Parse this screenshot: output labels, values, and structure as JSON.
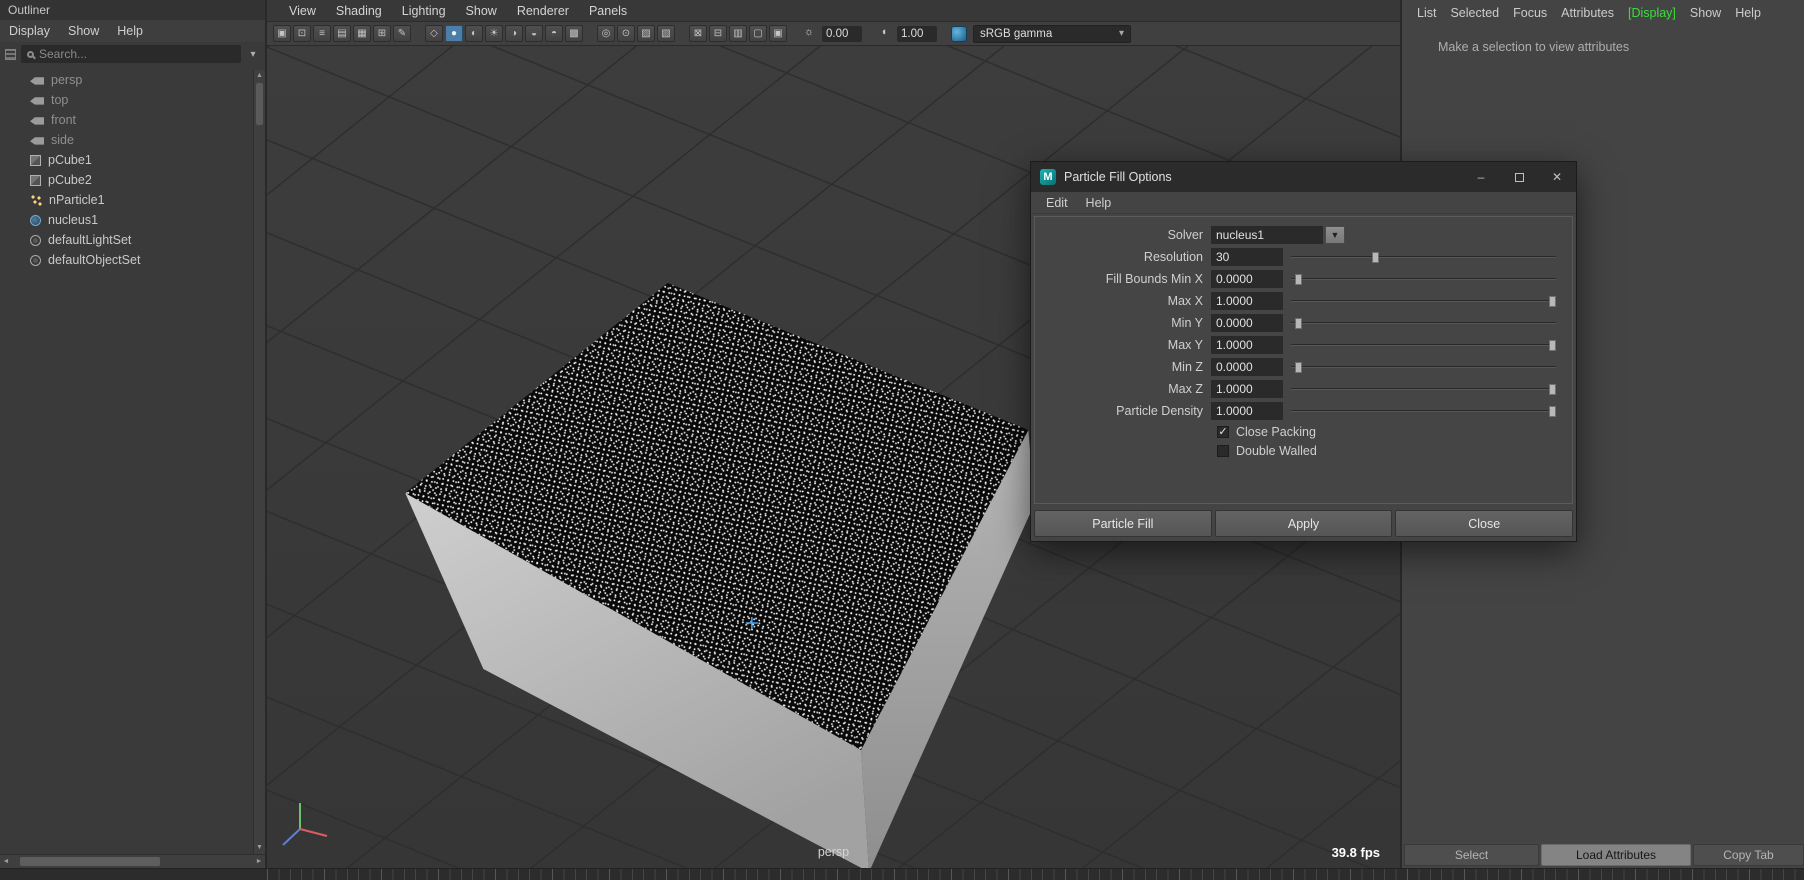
{
  "glyphs": {
    "dropdown_caret": "▾",
    "dropdown_arrow": "▼",
    "checkmark": "✓",
    "scroll_up": "▲",
    "scroll_down": "▼",
    "scroll_left": "◄",
    "scroll_right": "►",
    "minimize": "–",
    "close": "✕"
  },
  "outliner": {
    "title": "Outliner",
    "menus": [
      "Display",
      "Show",
      "Help"
    ],
    "search_placeholder": "Search...",
    "items": [
      {
        "label": "persp",
        "icon": "camera",
        "icon_name": "camera-icon",
        "dim": true
      },
      {
        "label": "top",
        "icon": "camera",
        "icon_name": "camera-icon",
        "dim": true
      },
      {
        "label": "front",
        "icon": "camera",
        "icon_name": "camera-icon",
        "dim": true
      },
      {
        "label": "side",
        "icon": "camera",
        "icon_name": "camera-icon",
        "dim": true
      },
      {
        "label": "pCube1",
        "icon": "cube",
        "icon_name": "poly-cube-icon"
      },
      {
        "label": "pCube2",
        "icon": "cube",
        "icon_name": "poly-cube-icon"
      },
      {
        "label": "nParticle1",
        "icon": "particle",
        "icon_name": "nparticle-icon"
      },
      {
        "label": "nucleus1",
        "icon": "nucleus",
        "icon_name": "nucleus-icon"
      },
      {
        "label": "defaultLightSet",
        "icon": "set",
        "icon_name": "light-set-icon"
      },
      {
        "label": "defaultObjectSet",
        "icon": "set",
        "icon_name": "object-set-icon"
      }
    ]
  },
  "viewport": {
    "menus": [
      "View",
      "Shading",
      "Lighting",
      "Show",
      "Renderer",
      "Panels"
    ],
    "toolbar": {
      "icons": [
        {
          "name": "select-camera-icon",
          "glyph": "▣"
        },
        {
          "name": "lock-camera-icon",
          "glyph": "⊡"
        },
        {
          "name": "camera-attributes-icon",
          "glyph": "≡"
        },
        {
          "name": "bookmarks-icon",
          "glyph": "▤"
        },
        {
          "name": "image-plane-icon",
          "glyph": "▦"
        },
        {
          "name": "2d-pan-zoom-icon",
          "glyph": "⊞"
        },
        {
          "name": "grease-pencil-icon",
          "glyph": "✎"
        },
        {
          "name": "wireframe-icon",
          "glyph": "◇",
          "gap": true
        },
        {
          "name": "smooth-shade-icon",
          "glyph": "●",
          "active": true
        },
        {
          "name": "textured-icon",
          "glyph": "◐"
        },
        {
          "name": "use-all-lights-icon",
          "glyph": "☀"
        },
        {
          "name": "shadows-icon",
          "glyph": "◑"
        },
        {
          "name": "screen-space-ao-icon",
          "glyph": "◒"
        },
        {
          "name": "motion-blur-icon",
          "glyph": "◓"
        },
        {
          "name": "multisample-icon",
          "glyph": "▩"
        },
        {
          "name": "depth-of-field-icon",
          "glyph": "◎",
          "gap": true
        },
        {
          "name": "isolate-select-icon",
          "glyph": "⊙"
        },
        {
          "name": "xray-icon",
          "glyph": "▨"
        },
        {
          "name": "xray-joints-icon",
          "glyph": "▧"
        },
        {
          "name": "resolution-gate-icon",
          "glyph": "⊠",
          "gap": true
        },
        {
          "name": "gate-mask-icon",
          "glyph": "⊟"
        },
        {
          "name": "field-chart-icon",
          "glyph": "▥"
        },
        {
          "name": "safe-action-icon",
          "glyph": "▢"
        },
        {
          "name": "safe-title-icon",
          "glyph": "▣"
        }
      ],
      "exposure_value": "0.00",
      "gamma_value": "1.00",
      "view_transform": "sRGB gamma"
    },
    "camera_label": "persp",
    "fps_label": "39.8 fps"
  },
  "attribute_editor": {
    "menus": [
      {
        "label": "List"
      },
      {
        "label": "Selected"
      },
      {
        "label": "Focus"
      },
      {
        "label": "Attributes"
      },
      {
        "label": "[Display]",
        "active": true
      },
      {
        "label": "Show"
      },
      {
        "label": "Help"
      }
    ],
    "message": "Make a selection to view attributes",
    "buttons": [
      {
        "label": "Select"
      },
      {
        "label": "Load Attributes",
        "light": true
      },
      {
        "label": "Copy Tab"
      }
    ]
  },
  "dialog": {
    "title": "Particle Fill Options",
    "app_icon_letter": "M",
    "menus": [
      "Edit",
      "Help"
    ],
    "solver": {
      "label": "Solver",
      "value": "nucleus1"
    },
    "fields": [
      {
        "label": "Resolution",
        "value": "30",
        "slider": 0.32
      },
      {
        "label": "Fill Bounds Min X",
        "value": "0.0000",
        "slider": 0.03
      },
      {
        "label": "Max X",
        "value": "1.0000",
        "slider": 0.98
      },
      {
        "label": "Min Y",
        "value": "0.0000",
        "slider": 0.03
      },
      {
        "label": "Max Y",
        "value": "1.0000",
        "slider": 0.98
      },
      {
        "label": "Min Z",
        "value": "0.0000",
        "slider": 0.03
      },
      {
        "label": "Max Z",
        "value": "1.0000",
        "slider": 0.98
      },
      {
        "label": "Particle Density",
        "value": "1.0000",
        "slider": 0.98
      }
    ],
    "checkboxes": [
      {
        "label": "Close Packing",
        "checked": true
      },
      {
        "label": "Double Walled",
        "checked": false
      }
    ],
    "buttons": [
      "Particle Fill",
      "Apply",
      "Close"
    ]
  },
  "colors": {
    "accent_green": "#3bde3b",
    "active_icon_blue": "#4c7ea8",
    "maya_teal": "#0e8f8f"
  }
}
